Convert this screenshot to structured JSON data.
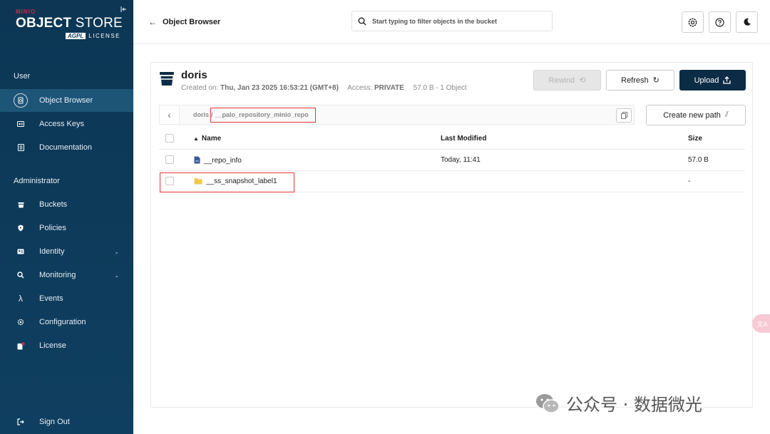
{
  "sidebar": {
    "logo": {
      "brand": "MINIO",
      "product_bold": "OBJECT",
      "product": "STORE",
      "badge": "AGPL",
      "license": "LICENSE"
    },
    "sections": {
      "user": "User",
      "admin": "Administrator"
    },
    "user_items": [
      {
        "label": "Object Browser",
        "icon": "object-browser-icon"
      },
      {
        "label": "Access Keys",
        "icon": "key-icon"
      },
      {
        "label": "Documentation",
        "icon": "document-icon"
      }
    ],
    "admin_items": [
      {
        "label": "Buckets",
        "icon": "bucket-icon"
      },
      {
        "label": "Policies",
        "icon": "shield-icon"
      },
      {
        "label": "Identity",
        "icon": "identity-icon"
      },
      {
        "label": "Monitoring",
        "icon": "magnify-icon"
      },
      {
        "label": "Events",
        "icon": "lambda-icon"
      },
      {
        "label": "Configuration",
        "icon": "gear-icon"
      },
      {
        "label": "License",
        "icon": "license-icon"
      }
    ],
    "events_glyph": "λ",
    "sign_out": "Sign Out"
  },
  "header": {
    "back_label": "Object Browser",
    "search_placeholder": "Start typing to filter objects in the bucket"
  },
  "bucket": {
    "name": "doris",
    "created_label": "Created on:",
    "created_value": "Thu, Jan 23 2025 16:53:21 (GMT+8)",
    "access_label": "Access:",
    "access_value": "PRIVATE",
    "summary": "57.0 B - 1 Object"
  },
  "buttons": {
    "rewind": "Rewind",
    "refresh": "Refresh",
    "upload": "Upload",
    "create_path": "Create new path"
  },
  "path": {
    "root": "doris",
    "separator": "/",
    "folder": "__palo_repository_minio_repo"
  },
  "table": {
    "columns": {
      "name": "Name",
      "modified": "Last Modified",
      "size": "Size"
    },
    "rows": [
      {
        "name": "__repo_info",
        "type": "file",
        "modified": "Today, 11:41",
        "size": "57.0 B"
      },
      {
        "name": "__ss_snapshot_label1",
        "type": "folder",
        "modified": "",
        "size": "-"
      }
    ]
  },
  "watermark": {
    "text": "公众号 · 数据微光"
  },
  "float_badge": "文A",
  "colors": {
    "sidebar": "#0f3d5c",
    "active": "#1d5577",
    "primary": "#0c2c45",
    "highlight": "#e53935",
    "folder": "#f2c94c",
    "file": "#3a5a9b"
  }
}
